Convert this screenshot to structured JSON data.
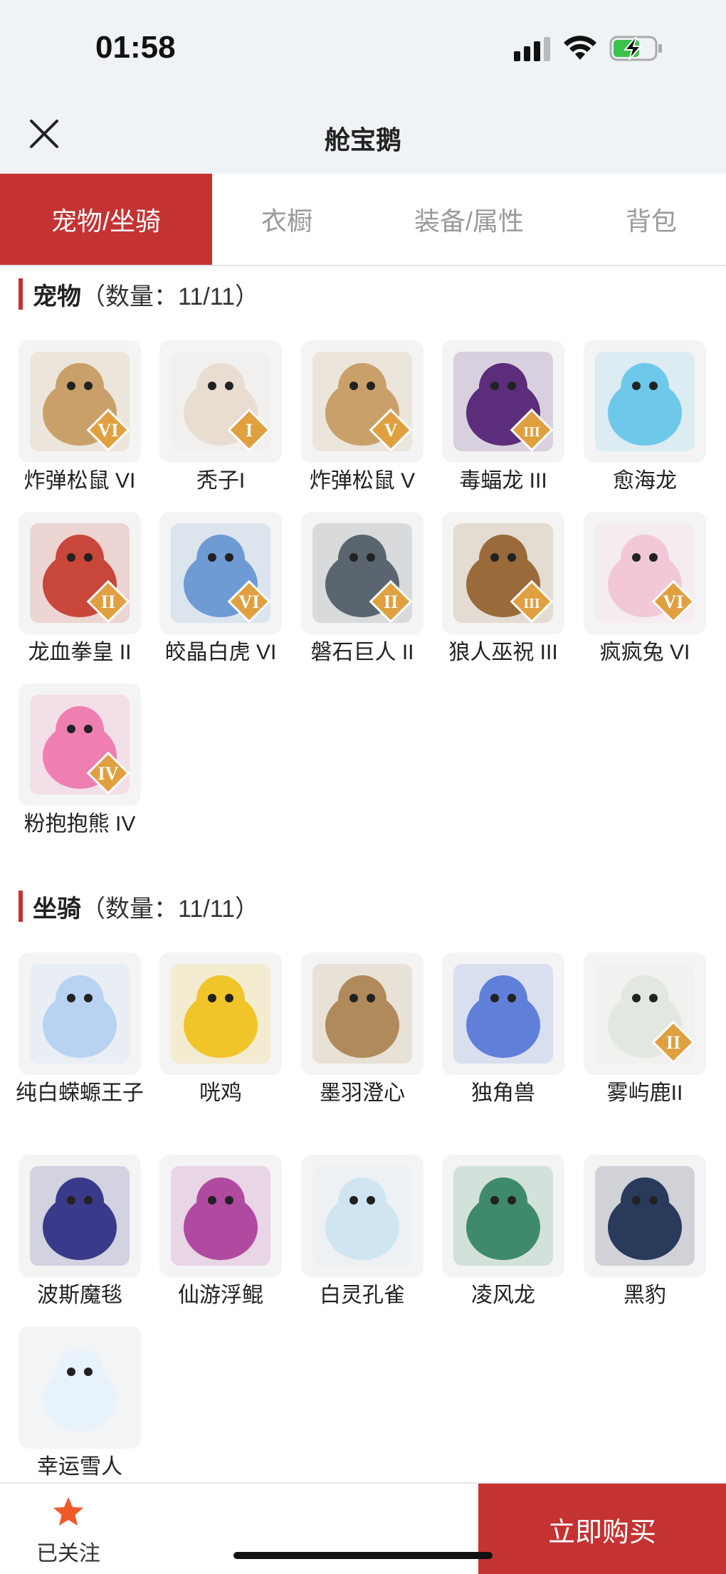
{
  "status": {
    "time": "01:58"
  },
  "nav": {
    "title": "舱宝鹅"
  },
  "tabs": [
    {
      "label": "宠物/坐骑",
      "active": true
    },
    {
      "label": "衣橱",
      "active": false
    },
    {
      "label": "装备/属性",
      "active": false
    },
    {
      "label": "背包",
      "active": false
    }
  ],
  "pets": {
    "title": "宠物",
    "count": "（数量：11/11）",
    "items": [
      {
        "name": "炸弹松鼠 VI",
        "badge": "VI",
        "color": "#c9a06a"
      },
      {
        "name": "秃子I",
        "badge": "I",
        "color": "#e8ddd0"
      },
      {
        "name": "炸弹松鼠 V",
        "badge": "V",
        "color": "#c9a06a"
      },
      {
        "name": "毒蝠龙 III",
        "badge": "III",
        "color": "#5b2d7a"
      },
      {
        "name": "愈海龙",
        "badge": "",
        "color": "#6ec8ea"
      },
      {
        "name": "龙血拳皇 II",
        "badge": "II",
        "color": "#c8463a"
      },
      {
        "name": "皎晶白虎 VI",
        "badge": "VI",
        "color": "#6f9bd4"
      },
      {
        "name": "磐石巨人 II",
        "badge": "II",
        "color": "#5a6570"
      },
      {
        "name": "狼人巫祝 III",
        "badge": "III",
        "color": "#9a6a3a"
      },
      {
        "name": "疯疯兔 VI",
        "badge": "VI",
        "color": "#f2c8d8"
      },
      {
        "name": "粉抱抱熊 IV",
        "badge": "IV",
        "color": "#ee7fb0"
      }
    ]
  },
  "mounts": {
    "title": "坐骑",
    "count": "（数量：11/11）",
    "items": [
      {
        "name": "纯白蝾螈王子",
        "badge": "",
        "color": "#b8d2f2"
      },
      {
        "name": "咣鸡",
        "badge": "",
        "color": "#f0c52a"
      },
      {
        "name": "墨羽澄心",
        "badge": "",
        "color": "#b08a5a"
      },
      {
        "name": "独角兽",
        "badge": "",
        "color": "#5f7fd8"
      },
      {
        "name": "雾屿鹿II",
        "badge": "II",
        "color": "#e2e8e0"
      },
      {
        "name": "波斯魔毯",
        "badge": "",
        "color": "#3a3a8a"
      },
      {
        "name": "仙游浮鲲",
        "badge": "",
        "color": "#b04aa0"
      },
      {
        "name": "白灵孔雀",
        "badge": "",
        "color": "#cfe6f2"
      },
      {
        "name": "凌风龙",
        "badge": "",
        "color": "#3f8a6a"
      },
      {
        "name": "黑豹",
        "badge": "",
        "color": "#2a3a5a"
      },
      {
        "name": "幸运雪人",
        "badge": "",
        "color": "#e8f2fa"
      }
    ]
  },
  "bottom": {
    "follow_label": "已关注",
    "buy_label": "立即购买"
  },
  "colors": {
    "accent": "#c53232",
    "nav_bg": "#eff3f6",
    "star": "#ee5a2a",
    "badge": "#e0a040"
  }
}
